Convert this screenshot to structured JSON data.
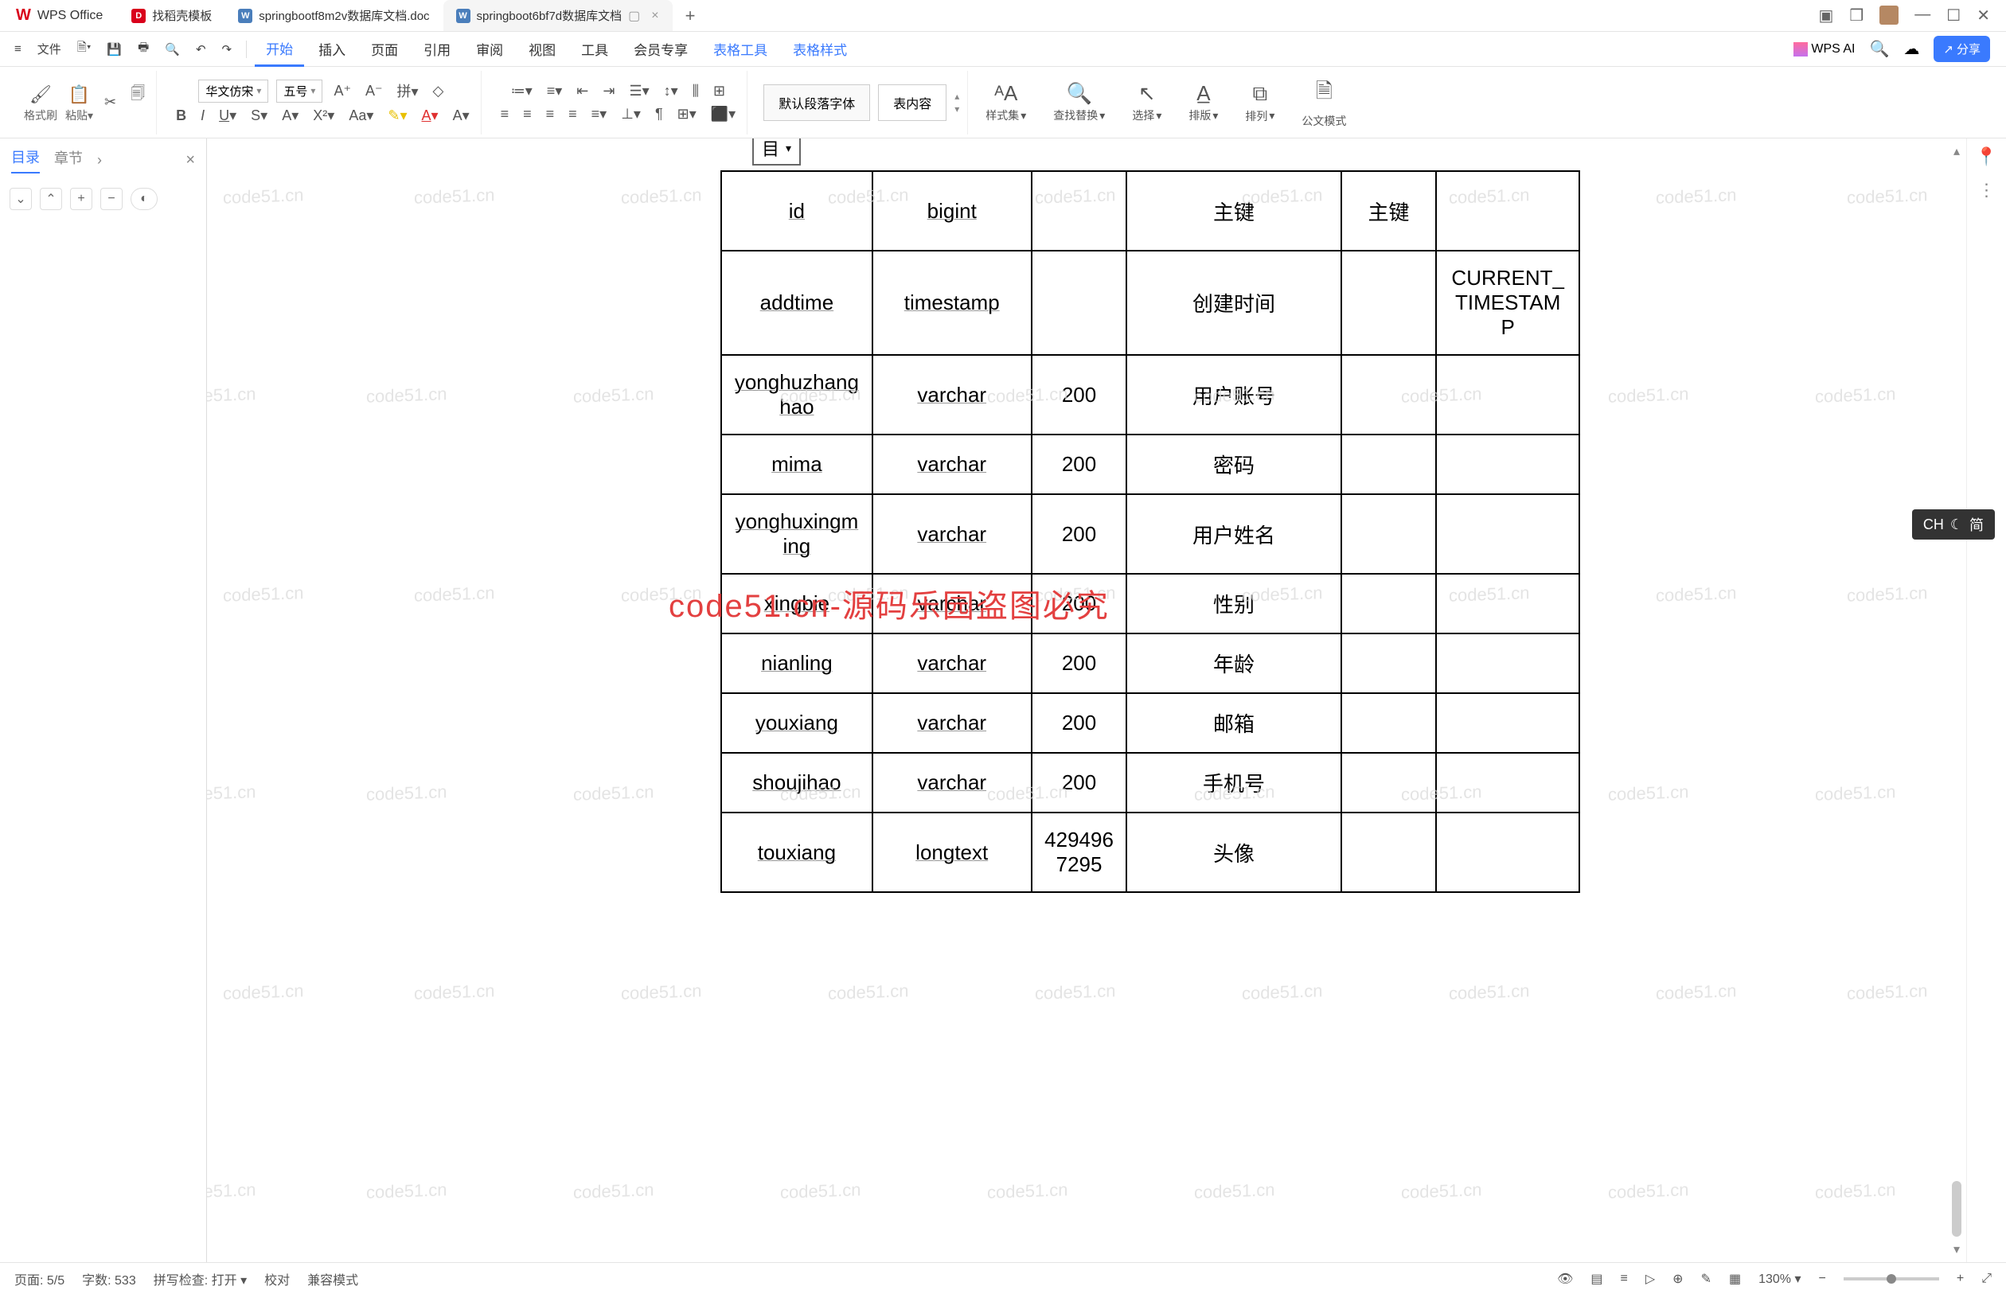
{
  "app": {
    "name": "WPS Office"
  },
  "tabs": [
    {
      "icon": "D",
      "iconColor": "red",
      "label": "找稻壳模板"
    },
    {
      "icon": "W",
      "iconColor": "blue",
      "label": "springbootf8m2v数据库文档.doc"
    },
    {
      "icon": "W",
      "iconColor": "blue",
      "label": "springboot6bf7d数据库文档",
      "active": true
    }
  ],
  "menu": {
    "file": "文件",
    "tabs": [
      "开始",
      "插入",
      "页面",
      "引用",
      "审阅",
      "视图",
      "工具",
      "会员专享",
      "表格工具",
      "表格样式"
    ],
    "activeIndex": 0,
    "wpsai": "WPS AI",
    "share": "分享"
  },
  "ribbon": {
    "formatBrush": "格式刷",
    "paste": "粘贴",
    "font": "华文仿宋",
    "size": "五号",
    "styleDefault": "默认段落字体",
    "styleTable": "表内容",
    "styleSet": "样式集",
    "findReplace": "查找替换",
    "select": "选择",
    "layout": "排版",
    "arrange": "排列",
    "officialMode": "公文模式"
  },
  "leftPanel": {
    "toc": "目录",
    "chapters": "章节"
  },
  "ime": {
    "label": "CH",
    "mode": "简"
  },
  "tableHeader": "目",
  "tableRows": [
    {
      "c1": "id",
      "c2": "bigint",
      "c3": "",
      "c4": "主键",
      "c5": "主键",
      "c6": ""
    },
    {
      "c1": "addtime",
      "c2": "timestamp",
      "c3": "",
      "c4": "创建时间",
      "c5": "",
      "c6": "CURRENT_TIMESTAMP"
    },
    {
      "c1": "yonghuzhanghao",
      "c2": "varchar",
      "c3": "200",
      "c4": "用户账号",
      "c5": "",
      "c6": ""
    },
    {
      "c1": "mima",
      "c2": "varchar",
      "c3": "200",
      "c4": "密码",
      "c5": "",
      "c6": ""
    },
    {
      "c1": "yonghuxingming",
      "c2": "varchar",
      "c3": "200",
      "c4": "用户姓名",
      "c5": "",
      "c6": ""
    },
    {
      "c1": "xingbie",
      "c2": "varchar",
      "c3": "200",
      "c4": "性别",
      "c5": "",
      "c6": ""
    },
    {
      "c1": "nianling",
      "c2": "varchar",
      "c3": "200",
      "c4": "年龄",
      "c5": "",
      "c6": ""
    },
    {
      "c1": "youxiang",
      "c2": "varchar",
      "c3": "200",
      "c4": "邮箱",
      "c5": "",
      "c6": ""
    },
    {
      "c1": "shoujihao",
      "c2": "varchar",
      "c3": "200",
      "c4": "手机号",
      "c5": "",
      "c6": ""
    },
    {
      "c1": "touxiang",
      "c2": "longtext",
      "c3": "4294967295",
      "c4": "头像",
      "c5": "",
      "c6": ""
    }
  ],
  "watermarkText": "code51.cn",
  "overlayText": "code51.cn-源码乐园盗图必究",
  "status": {
    "page": "页面: 5/5",
    "words": "字数: 533",
    "spellcheck": "拼写检查: 打开",
    "proof": "校对",
    "compat": "兼容模式",
    "zoom": "130%"
  }
}
